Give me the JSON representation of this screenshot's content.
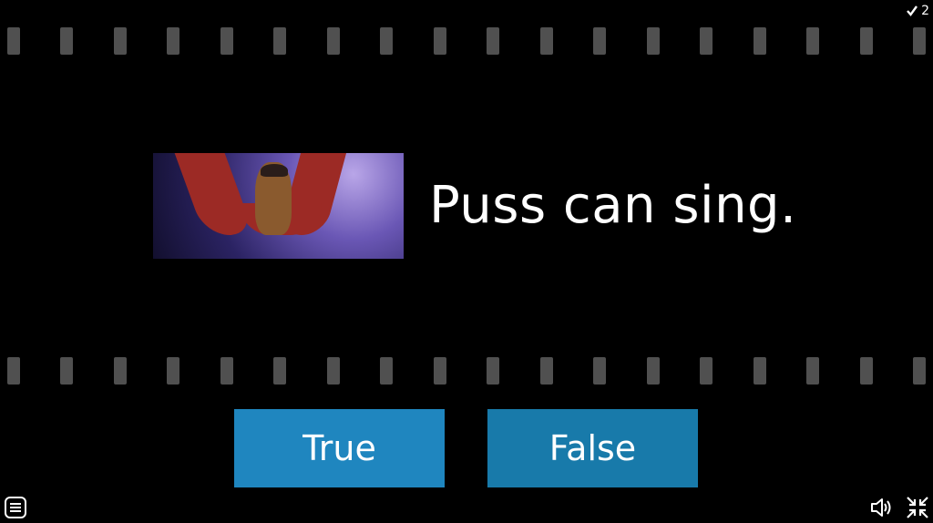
{
  "score": {
    "icon": "checkmark-icon",
    "value": "2"
  },
  "question": {
    "statement": "Puss can sing.",
    "image_alt": "Puss in Boots sitting on red fabric holding a guitar"
  },
  "answers": {
    "true_label": "True",
    "false_label": "False"
  },
  "controls": {
    "menu_icon": "menu-icon",
    "sound_icon": "speaker-icon",
    "fullscreen_icon": "exit-fullscreen-icon"
  },
  "colors": {
    "background": "#000000",
    "button_true": "#1f86bf",
    "button_false": "#187aaa",
    "filmstrip_hole": "#505050"
  }
}
